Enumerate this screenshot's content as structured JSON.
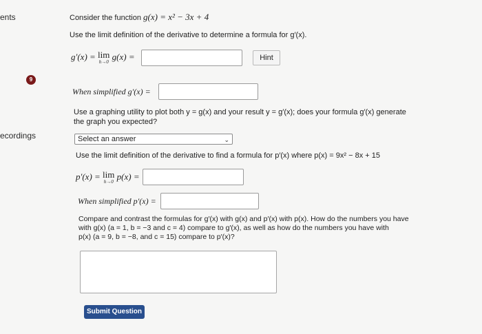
{
  "sidebar": {
    "fragment_top": "ents",
    "fragment_recordings": "ecordings"
  },
  "question": {
    "number_badge": "9",
    "intro_prefix": "Consider the function",
    "g_def": "g(x) = x² − 3x + 4",
    "part1_instruction": "Use the limit definition of the derivative to determine a formula for g′(x).",
    "limit_g": {
      "lhs": "g′(x) =",
      "lim": "lim",
      "sub": "h→0",
      "func": "g(x) ="
    },
    "hint_label": "Hint",
    "simplified_g_label": "When simplified g′(x) =",
    "graph_question_line1": "Use a graphing utility to plot both y = g(x) and your result y = g′(x); does your formula g′(x) generate",
    "graph_question_line2": "the graph you expected?",
    "select": {
      "value": "Select an answer"
    },
    "part2_instruction": "Use the limit definition of the derivative to find a formula for p′(x) where p(x) = 9x² − 8x + 15",
    "limit_p": {
      "lhs": "p′(x) =",
      "lim": "lim",
      "sub": "h→0",
      "func": "p(x) ="
    },
    "simplified_p_label": "When simplified p′(x) =",
    "compare_line1": "Compare and contrast the formulas for g′(x) with g(x) and p′(x) with p(x). How do the numbers you have",
    "compare_line2": "with g(x) (a = 1, b = −3 and c = 4) compare to g′(x), as well as how do the numbers you have with",
    "compare_line3": "p(x) (a = 9, b = −8, and c = 15) compare to p′(x)?",
    "answer_textarea": "",
    "submit_label": "Submit Question"
  }
}
